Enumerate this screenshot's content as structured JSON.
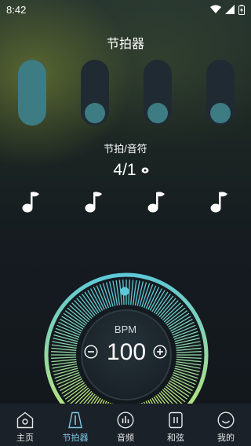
{
  "status_bar": {
    "time": "8:42"
  },
  "header": {
    "title": "节拍器"
  },
  "accent_color": "#3d7c83",
  "beat_sliders": [
    {
      "level": 1.0,
      "accented": true
    },
    {
      "level": 0.0,
      "accented": false
    },
    {
      "level": 0.0,
      "accented": false
    },
    {
      "level": 0.0,
      "accented": false
    }
  ],
  "beat": {
    "label": "节拍/音符",
    "value": "4/1"
  },
  "notes": [
    "quarter-note",
    "quarter-note",
    "quarter-note",
    "quarter-note"
  ],
  "tempo": {
    "label": "BPM",
    "value": "100",
    "dial_colors": [
      "#5ec8d8",
      "#c8e86e"
    ]
  },
  "nav": {
    "items": [
      {
        "label": "主页",
        "icon": "home-icon",
        "active": false
      },
      {
        "label": "节拍器",
        "icon": "metronome-icon",
        "active": true
      },
      {
        "label": "音频",
        "icon": "audio-icon",
        "active": false
      },
      {
        "label": "和弦",
        "icon": "chord-icon",
        "active": false
      },
      {
        "label": "我的",
        "icon": "profile-icon",
        "active": false
      }
    ]
  }
}
